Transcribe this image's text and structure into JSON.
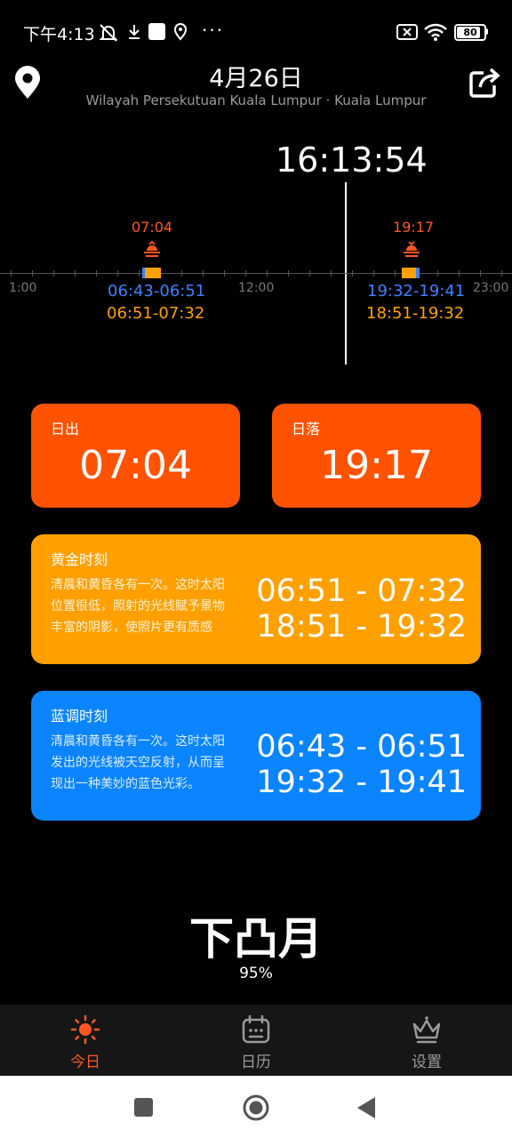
{
  "status_bar": {
    "time": "下午4:13",
    "battery": "80"
  },
  "header": {
    "date": "4月26日",
    "location": "Wilayah Persekutuan Kuala Lumpur · Kuala Lumpur"
  },
  "timeline": {
    "current_time": "16:13:54",
    "axis_labels": [
      "1:00",
      "12:00",
      "23:00"
    ],
    "sunrise_marker": "07:04",
    "sunset_marker": "19:17",
    "morning_blue": "06:43-06:51",
    "morning_golden": "06:51-07:32",
    "evening_blue": "19:32-19:41",
    "evening_golden": "18:51-19:32"
  },
  "sunrise_card": {
    "title": "日出",
    "time": "07:04"
  },
  "sunset_card": {
    "title": "日落",
    "time": "19:17"
  },
  "golden_card": {
    "title": "黄金时刻",
    "desc_lines": [
      "清晨和黄昏各有一次。这时太阳",
      "位置很低，照射的光线赋予景物",
      "丰富的阴影，使照片更有质感"
    ],
    "range1": "06:51 - 07:32",
    "range2": "18:51 - 19:32"
  },
  "blue_card": {
    "title": "蓝调时刻",
    "desc_lines": [
      "清晨和黄昏各有一次。这时太阳",
      "发出的光线被天空反射，从而呈",
      "现出一种美妙的蓝色光彩。"
    ],
    "range1": "06:43 - 06:51",
    "range2": "19:32 - 19:41"
  },
  "moon": {
    "phase": "下凸月",
    "illumination": "95%"
  },
  "nav": {
    "today": "今日",
    "calendar": "日历",
    "settings": "设置"
  },
  "colors": {
    "accent": "#ff5722",
    "sun_card": "#ff5200",
    "golden": "#ffa000",
    "blue": "#0a84ff"
  },
  "icons": {
    "location": "location-pin-icon",
    "share": "share-icon",
    "sunrise": "sunrise-icon",
    "sunset": "sunset-icon",
    "today": "sun-icon",
    "calendar": "calendar-icon",
    "settings": "crown-icon"
  }
}
